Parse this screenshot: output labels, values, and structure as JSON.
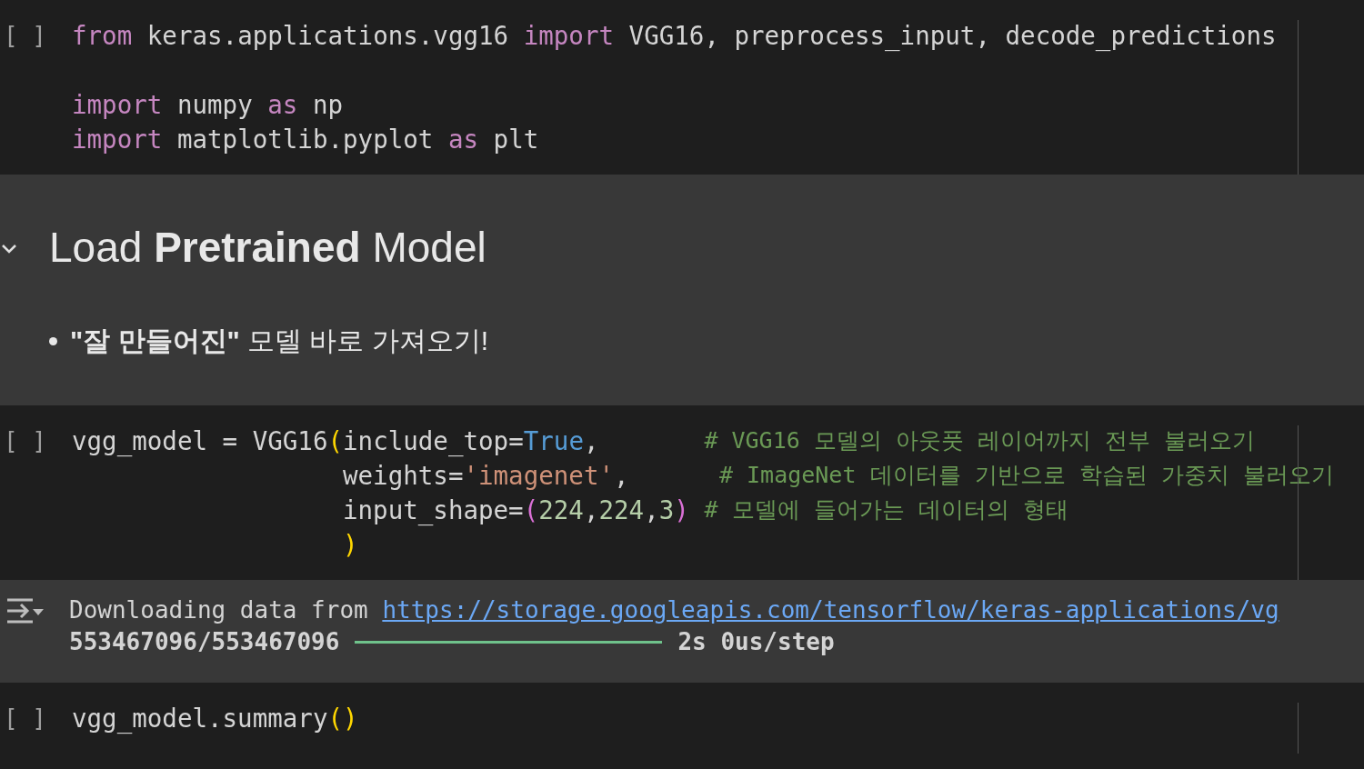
{
  "cells": [
    {
      "kind": "code",
      "run_marker": "[ ]",
      "lines": [
        {
          "tokens": [
            {
              "kind": "keyword",
              "t": "from"
            },
            {
              "kind": "plain",
              "t": " keras.applications.vgg16 "
            },
            {
              "kind": "keyword",
              "t": "import"
            },
            {
              "kind": "plain",
              "t": " VGG16, preprocess_input, decode_predictions"
            }
          ]
        },
        {
          "gap_before": true,
          "tokens": [
            {
              "kind": "keyword",
              "t": "import"
            },
            {
              "kind": "plain",
              "t": " numpy "
            },
            {
              "kind": "keyword",
              "t": "as"
            },
            {
              "kind": "plain",
              "t": " np"
            }
          ]
        },
        {
          "tokens": [
            {
              "kind": "keyword",
              "t": "import"
            },
            {
              "kind": "plain",
              "t": " matplotlib.pyplot "
            },
            {
              "kind": "keyword",
              "t": "as"
            },
            {
              "kind": "plain",
              "t": " plt"
            }
          ]
        }
      ]
    },
    {
      "kind": "text",
      "expanded": true,
      "heading": "Load **Pretrained** Model",
      "bullets": [
        "**\"잘 만들어진\"** 모델 바로 가져오기!"
      ]
    },
    {
      "kind": "code",
      "run_marker": "[ ]",
      "lines": [
        {
          "tokens": [
            {
              "kind": "plain",
              "t": "vgg_model = VGG16"
            },
            {
              "kind": "bracket",
              "t": "("
            },
            {
              "kind": "plain",
              "t": "include_top="
            },
            {
              "kind": "constant",
              "t": "True"
            },
            {
              "kind": "plain",
              "t": ",       "
            },
            {
              "kind": "comment",
              "t": "# VGG16 모델의 아웃풋 레이어까지 전부 불러오기"
            }
          ]
        },
        {
          "continued": true,
          "tokens": [
            {
              "kind": "plain",
              "t": "weights="
            },
            {
              "kind": "string",
              "t": "'imagenet'"
            },
            {
              "kind": "plain",
              "t": ",      "
            },
            {
              "kind": "comment",
              "t": "# ImageNet 데이터를 기반으로 학습된 가중치 불러오기"
            }
          ]
        },
        {
          "continued": true,
          "tokens": [
            {
              "kind": "plain",
              "t": "input_shape="
            },
            {
              "kind": "bracket2",
              "t": "("
            },
            {
              "kind": "number",
              "t": "224"
            },
            {
              "kind": "plain",
              "t": ","
            },
            {
              "kind": "number",
              "t": "224"
            },
            {
              "kind": "plain",
              "t": ","
            },
            {
              "kind": "number",
              "t": "3"
            },
            {
              "kind": "bracket2",
              "t": ") "
            },
            {
              "kind": "comment",
              "t": "# 모델에 들어가는 데이터의 형태"
            }
          ]
        },
        {
          "continued": true,
          "tokens": [
            {
              "kind": "bracket",
              "t": ")"
            }
          ]
        }
      ],
      "output": {
        "text": "Downloading data from",
        "link": "https://storage.googleapis.com/tensorflow/keras-applications/vg",
        "progress": {
          "count": "553467096/553467096",
          "level": 1,
          "timing": "2s 0us/step"
        }
      }
    },
    {
      "kind": "code",
      "run_marker": "[ ]",
      "lines": [
        {
          "tokens": [
            {
              "kind": "plain",
              "t": "vgg_model.summary"
            },
            {
              "kind": "bracket",
              "t": "()"
            }
          ]
        }
      ]
    }
  ]
}
